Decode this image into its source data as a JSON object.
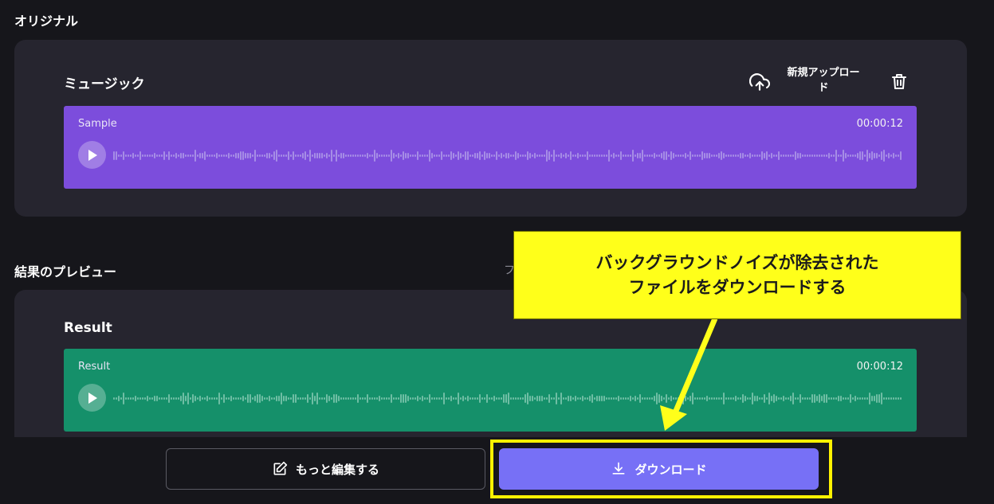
{
  "original": {
    "section_title": "オリジナル",
    "card_title": "ミュージック",
    "upload_label_line1": "新規アップロー",
    "upload_label_line2": "ド",
    "track": {
      "name": "Sample",
      "duration": "00:00:12",
      "color": "#7c4ddc",
      "wave_color": "#a68de6"
    }
  },
  "result": {
    "section_title": "結果のプレビュー",
    "right_hint_partial": "フ",
    "card_title": "Result",
    "track": {
      "name": "Result",
      "duration": "00:00:12",
      "color": "#15906a",
      "wave_color": "#6fbea4"
    }
  },
  "actions": {
    "edit_label": "もっと編集する",
    "download_label": "ダウンロード"
  },
  "annotation": {
    "line1": "バックグラウンドノイズが除去された",
    "line2": "ファイルをダウンロードする",
    "callout_color": "#ffff1a",
    "highlight_color": "#fff200"
  },
  "icons": {
    "upload": "cloud-upload-icon",
    "delete": "trash-icon",
    "play": "play-icon",
    "edit": "edit-icon",
    "download": "download-icon"
  },
  "colors": {
    "background": "#16161b",
    "panel": "#26252f",
    "accent": "#7770f6"
  }
}
